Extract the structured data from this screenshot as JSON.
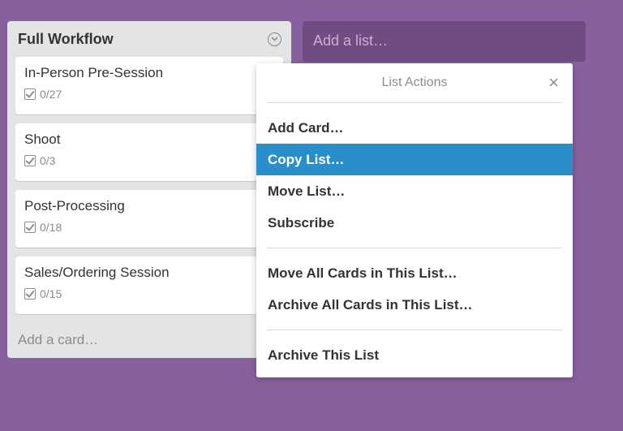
{
  "list": {
    "title": "Full Workflow",
    "menu_icon": "chevron-down-circle-icon",
    "cards": [
      {
        "title": "In-Person Pre-Session",
        "checklist": "0/27"
      },
      {
        "title": "Shoot",
        "checklist": "0/3"
      },
      {
        "title": "Post-Processing",
        "checklist": "0/18"
      },
      {
        "title": "Sales/Ordering Session",
        "checklist": "0/15"
      }
    ],
    "add_card_label": "Add a card…"
  },
  "add_list": {
    "label": "Add a list…"
  },
  "popover": {
    "title": "List Actions",
    "close_icon": "×",
    "group1": [
      "Add Card…",
      "Copy List…",
      "Move List…",
      "Subscribe"
    ],
    "group2": [
      "Move All Cards in This List…",
      "Archive All Cards in This List…"
    ],
    "group3": [
      "Archive This List"
    ],
    "active_item": "Copy List…"
  },
  "colors": {
    "board_bg": "#89609e",
    "list_bg": "#e2e4e6",
    "highlight": "#298fca"
  }
}
